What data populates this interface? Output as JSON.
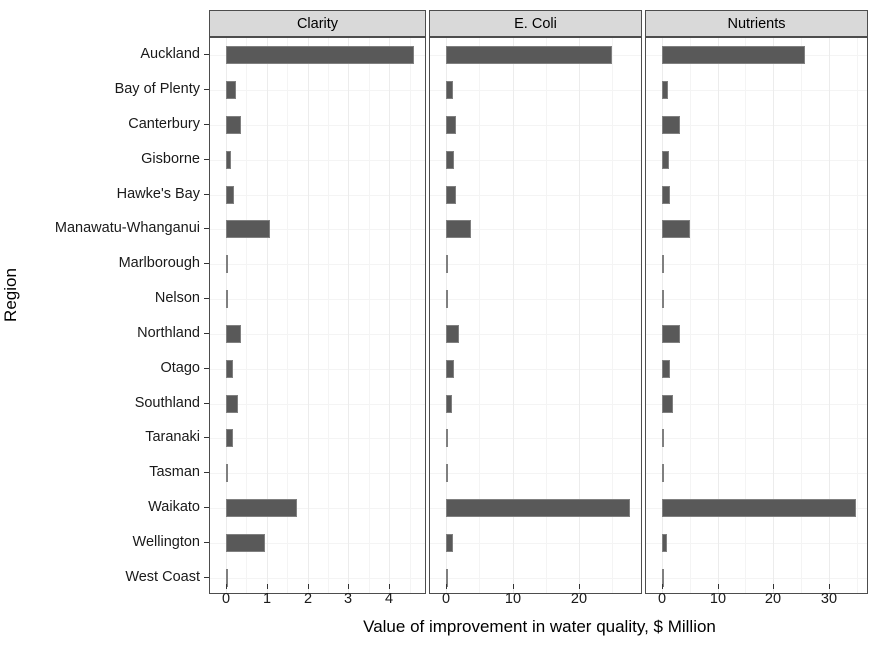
{
  "axes": {
    "y_title": "Region",
    "x_title": "Value of improvement in water quality, $ Million"
  },
  "panels": [
    {
      "label": "Clarity",
      "ticks": [
        0,
        1,
        2,
        3,
        4
      ],
      "minor_ticks": [
        0.5,
        1.5,
        2.5,
        3.5,
        4.5
      ],
      "xmin": 0,
      "xmax": 4.83
    },
    {
      "label": "E. Coli",
      "ticks": [
        0,
        10,
        20
      ],
      "minor_ticks": [
        5,
        15,
        25
      ],
      "xmin": 0,
      "xmax": 29.0
    },
    {
      "label": "Nutrients",
      "ticks": [
        0,
        10,
        20,
        30
      ],
      "minor_ticks": [
        5,
        15,
        25,
        35
      ],
      "xmin": 0,
      "xmax": 36.5
    }
  ],
  "regions": [
    "Auckland",
    "Bay of Plenty",
    "Canterbury",
    "Gisborne",
    "Hawke's Bay",
    "Manawatu-Whanganui",
    "Marlborough",
    "Nelson",
    "Northland",
    "Otago",
    "Southland",
    "Taranaki",
    "Tasman",
    "Waikato",
    "Wellington",
    "West Coast"
  ],
  "chart_data": {
    "type": "bar",
    "title": "",
    "xlabel": "Value of improvement in water quality, $ Million",
    "ylabel": "Region",
    "orientation": "horizontal",
    "facets": [
      "Clarity",
      "E. Coli",
      "Nutrients"
    ],
    "facet_layout": "columns",
    "grid": true,
    "legend": "none",
    "categories": [
      "Auckland",
      "Bay of Plenty",
      "Canterbury",
      "Gisborne",
      "Hawke's Bay",
      "Manawatu-Whanganui",
      "Marlborough",
      "Nelson",
      "Northland",
      "Otago",
      "Southland",
      "Taranaki",
      "Tasman",
      "Waikato",
      "Wellington",
      "West Coast"
    ],
    "series": [
      {
        "name": "Clarity",
        "xlim": [
          0,
          4.83
        ],
        "ticks": [
          0,
          1,
          2,
          3,
          4
        ],
        "values": [
          4.6,
          0.24,
          0.38,
          0.12,
          0.19,
          1.08,
          0.03,
          0.02,
          0.36,
          0.16,
          0.29,
          0.18,
          0.05,
          1.73,
          0.95,
          0.04
        ]
      },
      {
        "name": "E. Coli",
        "xlim": [
          0,
          29.0
        ],
        "ticks": [
          0,
          10,
          20
        ],
        "values": [
          24.9,
          1.1,
          1.5,
          1.2,
          1.5,
          3.7,
          0.3,
          0.2,
          2.0,
          1.2,
          0.9,
          0.3,
          0.2,
          27.7,
          1.0,
          0.1
        ]
      },
      {
        "name": "Nutrients",
        "xlim": [
          0,
          36.5
        ],
        "ticks": [
          0,
          10,
          20,
          30
        ],
        "values": [
          25.7,
          1.1,
          3.2,
          1.3,
          1.5,
          5.1,
          0.3,
          0.2,
          3.3,
          1.5,
          1.9,
          0.3,
          0.2,
          34.8,
          0.9,
          0.2
        ]
      }
    ],
    "colors": {
      "bar_fill": "#595959",
      "bar_stroke": "#808080",
      "strip_fill": "#d9d9d9",
      "grid": "#ececec"
    }
  }
}
